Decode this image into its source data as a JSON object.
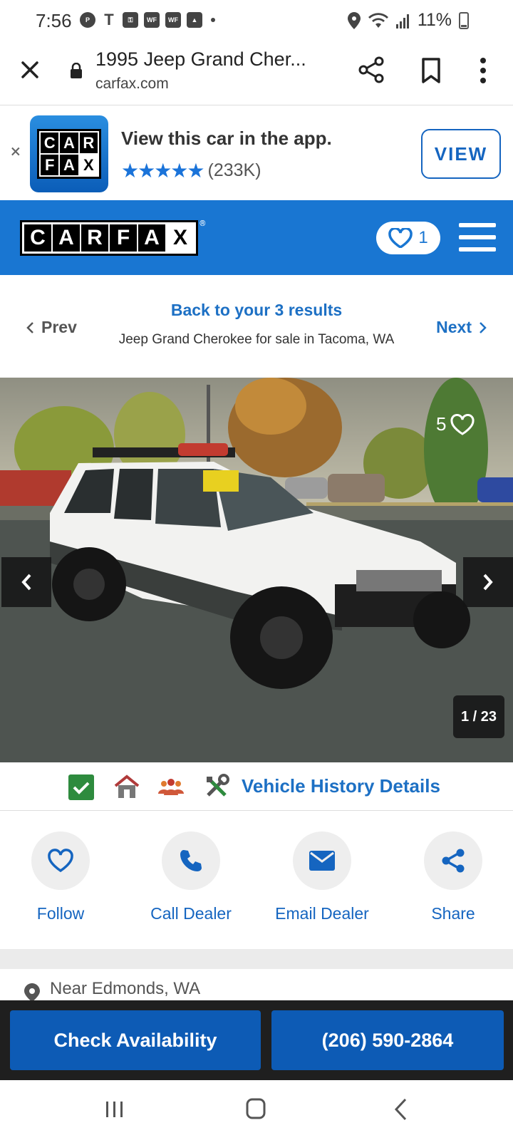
{
  "status_bar": {
    "time": "7:56",
    "left_icons": [
      "pinterest-icon",
      "tmobile-icon",
      "key-icon",
      "wf-icon",
      "wf-icon",
      "image-icon"
    ],
    "wf_label": "WF",
    "battery": "11%"
  },
  "browser": {
    "page_title": "1995 Jeep Grand Cher...",
    "domain": "carfax.com"
  },
  "app_banner": {
    "title": "View this car in the app.",
    "stars": "★★★★★",
    "rating_count": "(233K)",
    "view_label": "VIEW",
    "logo_letters": [
      "C",
      "A",
      "R",
      "F",
      "A",
      "X"
    ],
    "dismiss": "×"
  },
  "header": {
    "logo_letters": [
      "C",
      "A",
      "R",
      "F",
      "A",
      "X"
    ],
    "favorites_count": "1",
    "accent": "#1976d2"
  },
  "results_nav": {
    "prev_label": "Prev",
    "back_label": "Back to your 3 results",
    "context": "Jeep Grand Cherokee for sale in Tacoma, WA",
    "next_label": "Next"
  },
  "gallery": {
    "save_count": "5",
    "counter": "1 / 23"
  },
  "vehicle_history": {
    "label": "Vehicle History Details"
  },
  "actions": [
    {
      "label": "Follow",
      "icon": "heart-icon"
    },
    {
      "label": "Call Dealer",
      "icon": "phone-icon"
    },
    {
      "label": "Email Dealer",
      "icon": "mail-icon"
    },
    {
      "label": "Share",
      "icon": "share-icon"
    }
  ],
  "location": {
    "text": "Near Edmonds, WA"
  },
  "cta": {
    "availability_label": "Check Availability",
    "phone_label": "(206) 590-2864"
  }
}
